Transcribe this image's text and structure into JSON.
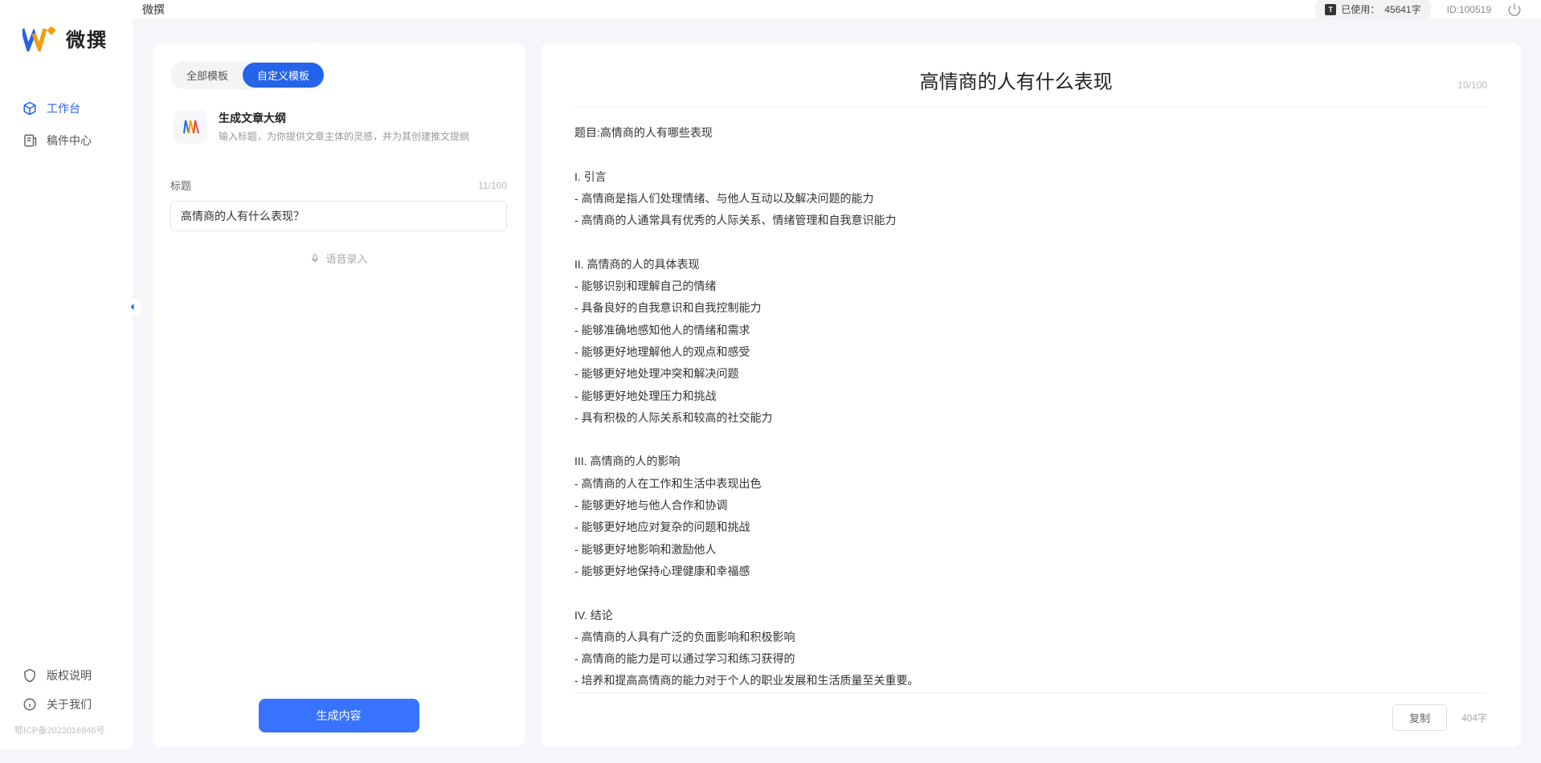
{
  "app": {
    "name": "微撰",
    "topbar_title": "微撰"
  },
  "topbar": {
    "usage_label": "已使用：",
    "usage_value": "45641字",
    "id_label": "ID:100519"
  },
  "sidebar": {
    "items": [
      {
        "label": "工作台"
      },
      {
        "label": "稿件中心"
      }
    ],
    "bottom": [
      {
        "label": "版权说明"
      },
      {
        "label": "关于我们"
      }
    ],
    "icp": "鄂ICP备2022016946号"
  },
  "left_panel": {
    "tabs": [
      {
        "label": "全部模板",
        "active": false
      },
      {
        "label": "自定义模板",
        "active": true
      }
    ],
    "template": {
      "title": "生成文章大纲",
      "desc": "输入标题，为你提供文章主体的灵感，并为其创建推文提纲"
    },
    "field": {
      "label": "标题",
      "counter": "11/100",
      "value": "高情商的人有什么表现？"
    },
    "voice_label": "语音录入",
    "generate_label": "生成内容"
  },
  "right_panel": {
    "title": "高情商的人有什么表现",
    "title_counter": "10/100",
    "body": "题目:高情商的人有哪些表现\n\nI. 引言\n- 高情商是指人们处理情绪、与他人互动以及解决问题的能力\n- 高情商的人通常具有优秀的人际关系、情绪管理和自我意识能力\n\nII. 高情商的人的具体表现\n- 能够识别和理解自己的情绪\n- 具备良好的自我意识和自我控制能力\n- 能够准确地感知他人的情绪和需求\n- 能够更好地理解他人的观点和感受\n- 能够更好地处理冲突和解决问题\n- 能够更好地处理压力和挑战\n- 具有积极的人际关系和较高的社交能力\n\nIII. 高情商的人的影响\n- 高情商的人在工作和生活中表现出色\n- 能够更好地与他人合作和协调\n- 能够更好地应对复杂的问题和挑战\n- 能够更好地影响和激励他人\n- 能够更好地保持心理健康和幸福感\n\nIV. 结论\n- 高情商的人具有广泛的负面影响和积极影响\n- 高情商的能力是可以通过学习和练习获得的\n- 培养和提高高情商的能力对于个人的职业发展和生活质量至关重要。",
    "copy_label": "复制",
    "word_count": "404字"
  }
}
